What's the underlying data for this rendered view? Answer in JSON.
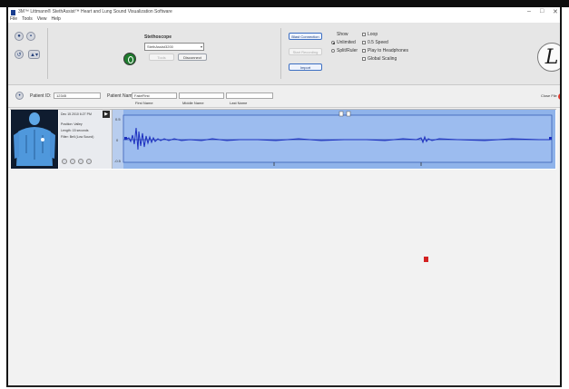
{
  "window": {
    "title": "3M™ Littmann® StethAssist™ Heart and Lung Sound Visualization Software",
    "controls": [
      "–",
      "□",
      "✕"
    ]
  },
  "menu": [
    "File",
    "Tools",
    "View",
    "Help"
  ],
  "stethoscope": {
    "heading": "Stethoscope",
    "selected": "StethAssist3200",
    "buttons": [
      "Tools",
      "Disconnect"
    ]
  },
  "actions": {
    "sound_source": "Blast Connection",
    "sound_source_secondary": "Start Recording",
    "import": "Import"
  },
  "view_options": {
    "group_label": "Show",
    "modes": [
      {
        "label": "Unlimited",
        "checked": true
      },
      {
        "label": "Split/Ruler",
        "checked": false
      }
    ],
    "options": [
      "Loop",
      "0.5 Speed",
      "Play to Headphones",
      "Global Scaling"
    ]
  },
  "patient": {
    "id_label": "Patient ID:",
    "id_value": "12345",
    "name_label": "Patient Name:",
    "first_name_value": "FakeFirst",
    "first_name_caption": "First Name",
    "middle_name_caption": "Middle Name",
    "last_name_caption": "Last Name",
    "close_label": "Close File"
  },
  "recording": {
    "date": "Dec 15 2010 6:27 PM",
    "position": "Position: Valley",
    "length": "Length: 15 seconds",
    "filter": "Filter: Bell (Low Sound)",
    "axis_top": "0.5",
    "axis_mid": "0",
    "axis_bottom": "-0.5"
  },
  "colors": {
    "waveform": "#1c2fbf",
    "marker": "#d32222"
  }
}
